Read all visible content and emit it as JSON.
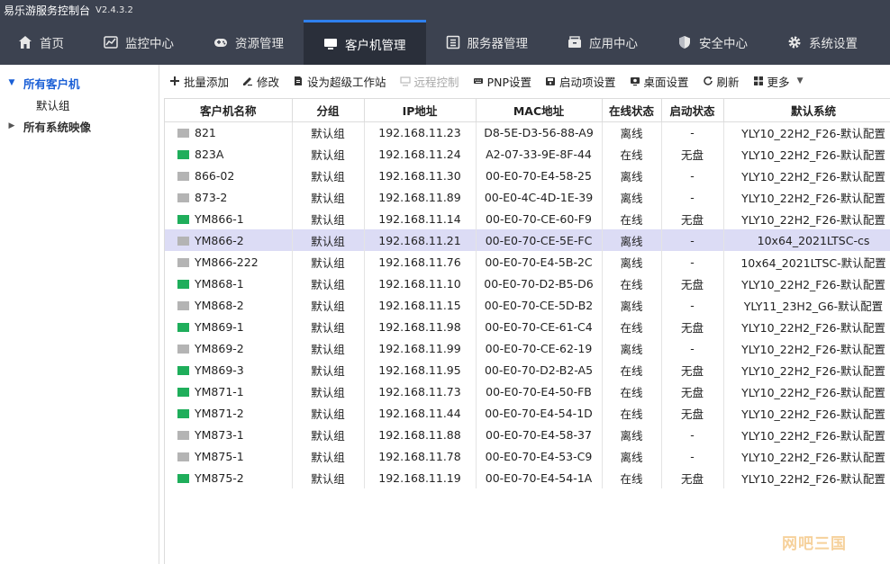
{
  "app": {
    "title": "易乐游服务控制台",
    "version": "V2.4.3.2"
  },
  "nav": [
    {
      "label": "首页",
      "icon": "home-icon",
      "active": false
    },
    {
      "label": "监控中心",
      "icon": "chart-icon",
      "active": false
    },
    {
      "label": "资源管理",
      "icon": "gamepad-icon",
      "active": false
    },
    {
      "label": "客户机管理",
      "icon": "monitor-icon",
      "active": true
    },
    {
      "label": "服务器管理",
      "icon": "server-icon",
      "active": false
    },
    {
      "label": "应用中心",
      "icon": "app-box-icon",
      "active": false
    },
    {
      "label": "安全中心",
      "icon": "shield-icon",
      "active": false
    },
    {
      "label": "系统设置",
      "icon": "gear-icon",
      "active": false
    }
  ],
  "sidebar": {
    "all_clients": "所有客户机",
    "default_group": "默认组",
    "all_images": "所有系统映像"
  },
  "toolbar": {
    "batch_add": "批量添加",
    "edit": "修改",
    "set_super": "设为超级工作站",
    "remote_control": "远程控制",
    "pnp": "PNP设置",
    "boot_items": "启动项设置",
    "desktop": "桌面设置",
    "refresh": "刷新",
    "more": "更多"
  },
  "table": {
    "columns": [
      "客户机名称",
      "分组",
      "IP地址",
      "MAC地址",
      "在线状态",
      "启动状态",
      "默认系统"
    ],
    "rows": [
      {
        "name": "821",
        "group": "默认组",
        "ip": "192.168.11.23",
        "mac": "D8-5E-D3-56-88-A9",
        "online": "离线",
        "boot": "-",
        "system": "YLY10_22H2_F26-默认配置",
        "status": "offline"
      },
      {
        "name": "823A",
        "group": "默认组",
        "ip": "192.168.11.24",
        "mac": "A2-07-33-9E-8F-44",
        "online": "在线",
        "boot": "无盘",
        "system": "YLY10_22H2_F26-默认配置",
        "status": "online"
      },
      {
        "name": "866-02",
        "group": "默认组",
        "ip": "192.168.11.30",
        "mac": "00-E0-70-E4-58-25",
        "online": "离线",
        "boot": "-",
        "system": "YLY10_22H2_F26-默认配置",
        "status": "offline"
      },
      {
        "name": "873-2",
        "group": "默认组",
        "ip": "192.168.11.89",
        "mac": "00-E0-4C-4D-1E-39",
        "online": "离线",
        "boot": "-",
        "system": "YLY10_22H2_F26-默认配置",
        "status": "offline"
      },
      {
        "name": "YM866-1",
        "group": "默认组",
        "ip": "192.168.11.14",
        "mac": "00-E0-70-CE-60-F9",
        "online": "在线",
        "boot": "无盘",
        "system": "YLY10_22H2_F26-默认配置",
        "status": "online"
      },
      {
        "name": "YM866-2",
        "group": "默认组",
        "ip": "192.168.11.21",
        "mac": "00-E0-70-CE-5E-FC",
        "online": "离线",
        "boot": "-",
        "system": "10x64_2021LTSC-cs",
        "status": "offline",
        "selected": true
      },
      {
        "name": "YM866-222",
        "group": "默认组",
        "ip": "192.168.11.76",
        "mac": "00-E0-70-E4-5B-2C",
        "online": "离线",
        "boot": "-",
        "system": "10x64_2021LTSC-默认配置",
        "status": "offline"
      },
      {
        "name": "YM868-1",
        "group": "默认组",
        "ip": "192.168.11.10",
        "mac": "00-E0-70-D2-B5-D6",
        "online": "在线",
        "boot": "无盘",
        "system": "YLY10_22H2_F26-默认配置",
        "status": "online"
      },
      {
        "name": "YM868-2",
        "group": "默认组",
        "ip": "192.168.11.15",
        "mac": "00-E0-70-CE-5D-B2",
        "online": "离线",
        "boot": "-",
        "system": "YLY11_23H2_G6-默认配置",
        "status": "offline"
      },
      {
        "name": "YM869-1",
        "group": "默认组",
        "ip": "192.168.11.98",
        "mac": "00-E0-70-CE-61-C4",
        "online": "在线",
        "boot": "无盘",
        "system": "YLY10_22H2_F26-默认配置",
        "status": "online"
      },
      {
        "name": "YM869-2",
        "group": "默认组",
        "ip": "192.168.11.99",
        "mac": "00-E0-70-CE-62-19",
        "online": "离线",
        "boot": "-",
        "system": "YLY10_22H2_F26-默认配置",
        "status": "offline"
      },
      {
        "name": "YM869-3",
        "group": "默认组",
        "ip": "192.168.11.95",
        "mac": "00-E0-70-D2-B2-A5",
        "online": "在线",
        "boot": "无盘",
        "system": "YLY10_22H2_F26-默认配置",
        "status": "online"
      },
      {
        "name": "YM871-1",
        "group": "默认组",
        "ip": "192.168.11.73",
        "mac": "00-E0-70-E4-50-FB",
        "online": "在线",
        "boot": "无盘",
        "system": "YLY10_22H2_F26-默认配置",
        "status": "online"
      },
      {
        "name": "YM871-2",
        "group": "默认组",
        "ip": "192.168.11.44",
        "mac": "00-E0-70-E4-54-1D",
        "online": "在线",
        "boot": "无盘",
        "system": "YLY10_22H2_F26-默认配置",
        "status": "online"
      },
      {
        "name": "YM873-1",
        "group": "默认组",
        "ip": "192.168.11.88",
        "mac": "00-E0-70-E4-58-37",
        "online": "离线",
        "boot": "-",
        "system": "YLY10_22H2_F26-默认配置",
        "status": "offline"
      },
      {
        "name": "YM875-1",
        "group": "默认组",
        "ip": "192.168.11.78",
        "mac": "00-E0-70-E4-53-C9",
        "online": "离线",
        "boot": "-",
        "system": "YLY10_22H2_F26-默认配置",
        "status": "offline"
      },
      {
        "name": "YM875-2",
        "group": "默认组",
        "ip": "192.168.11.19",
        "mac": "00-E0-70-E4-54-1A",
        "online": "在线",
        "boot": "无盘",
        "system": "YLY10_22H2_F26-默认配置",
        "status": "online"
      }
    ]
  },
  "watermark": "网吧三国",
  "colors": {
    "nav_bg": "#3c4250",
    "nav_active": "#2a2f3a",
    "selected_row": "#dcdcf5",
    "online_icon": "#1fae5b",
    "offline_icon": "#b4b4b4",
    "tree_selected": "#1a5fd6"
  }
}
